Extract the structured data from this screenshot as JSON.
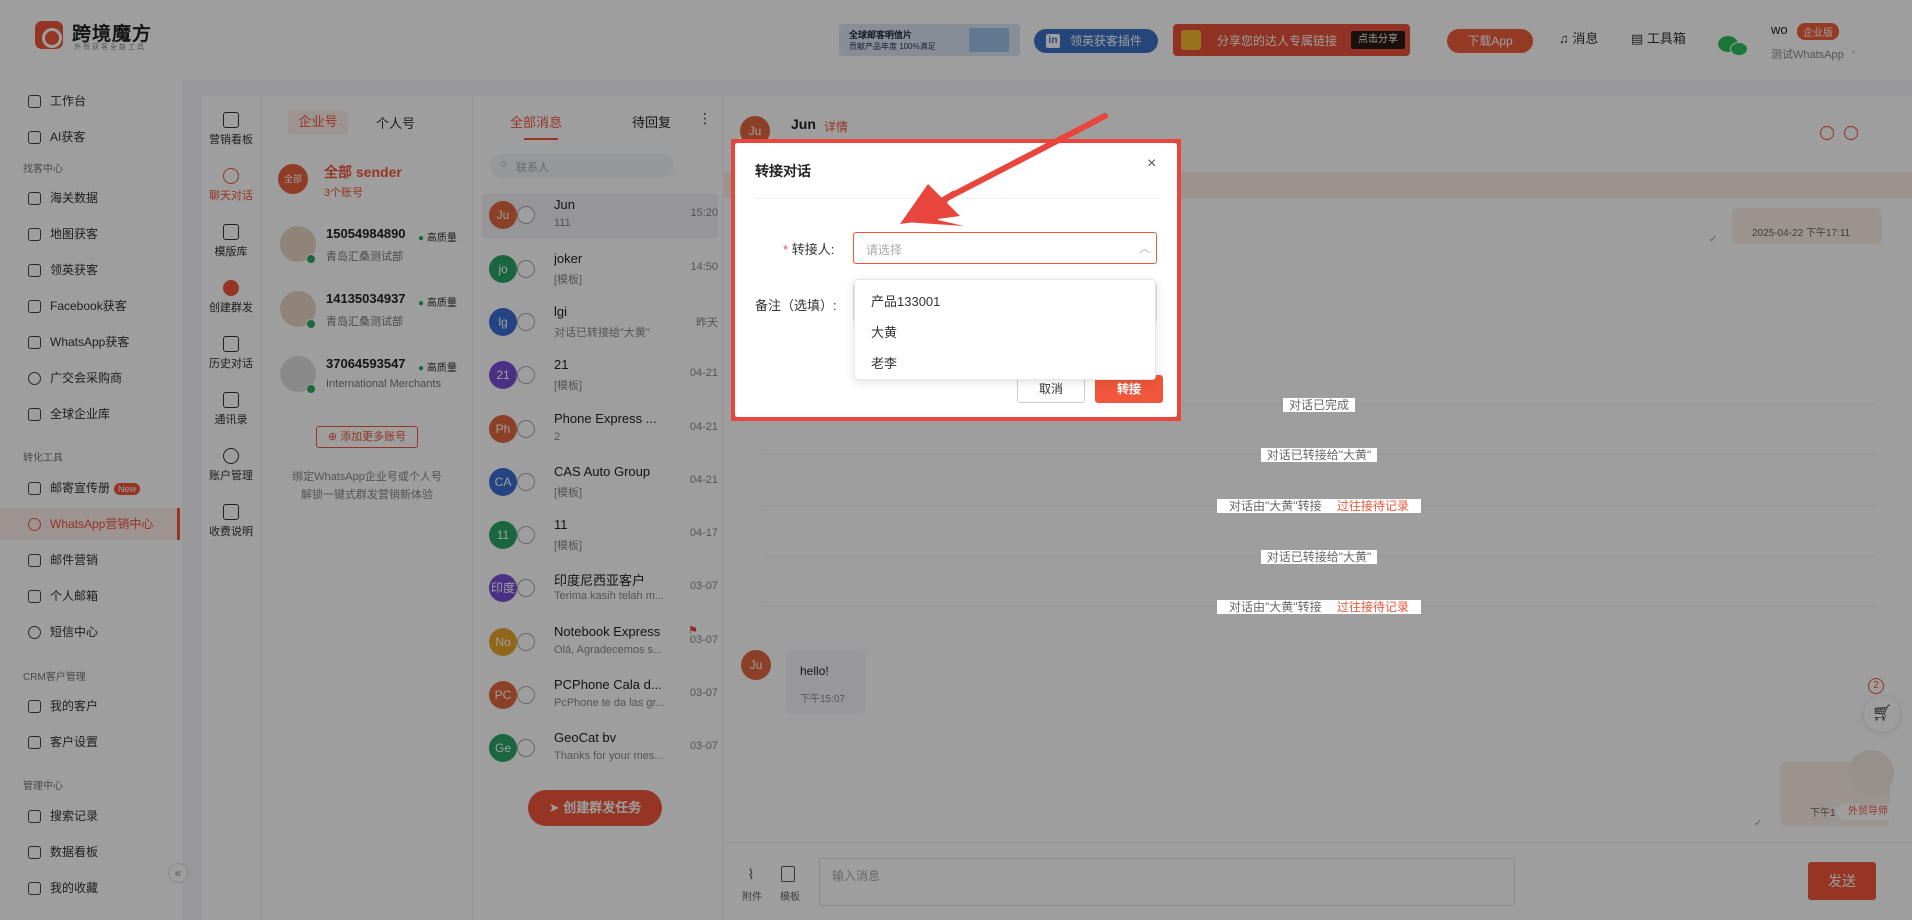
{
  "brand": {
    "name": "跨境魔方",
    "tagline": "外贸获客全能工具"
  },
  "header": {
    "banner1_line1": "全球邮客明信片",
    "banner1_line2": "贡献产品年度 100%满足",
    "linkedin_label": "领英获客插件",
    "share_label": "分享您的达人专属链接",
    "share_btn": "点击分享",
    "download_label": "下载App",
    "messages_label": "消息",
    "toolbox_label": "工具箱",
    "user_name": "wo",
    "user_badge": "企业版",
    "user_sub": "测试WhatsApp",
    "accent": "#f0563b"
  },
  "sidebar": {
    "top": [
      {
        "label": "工作台"
      },
      {
        "label": "AI获客"
      }
    ],
    "group1": "找客中心",
    "find": [
      {
        "label": "海关数据"
      },
      {
        "label": "地图获客"
      },
      {
        "label": "领英获客"
      },
      {
        "label": "Facebook获客"
      },
      {
        "label": "WhatsApp获客"
      },
      {
        "label": "广交会采购商"
      },
      {
        "label": "全球企业库"
      }
    ],
    "group2": "转化工具",
    "convert": [
      {
        "label": "邮寄宣传册"
      },
      {
        "label": "WhatsApp营销中心"
      },
      {
        "label": "邮件营销"
      },
      {
        "label": "个人邮箱"
      },
      {
        "label": "短信中心"
      }
    ],
    "new_badge": "New",
    "group3": "CRM客户管理",
    "crm": [
      {
        "label": "我的客户"
      },
      {
        "label": "客户设置"
      }
    ],
    "group4": "管理中心",
    "manage": [
      {
        "label": "搜索记录"
      },
      {
        "label": "数据看板"
      },
      {
        "label": "我的收藏"
      }
    ]
  },
  "tools": [
    {
      "label": "营销看板"
    },
    {
      "label": "聊天对话"
    },
    {
      "label": "模版库"
    },
    {
      "label": "创建群发"
    },
    {
      "label": "历史对话"
    },
    {
      "label": "通讯录"
    },
    {
      "label": "账户管理"
    },
    {
      "label": "收费说明"
    }
  ],
  "accounts": {
    "tab_business": "企业号",
    "tab_personal": "个人号",
    "all_sender": "全部 sender",
    "all_badge": "全部",
    "count": "3个账号",
    "quality": "高质量",
    "items": [
      {
        "number": "15054984890",
        "sub": "青岛汇桑测试部"
      },
      {
        "number": "14135034937",
        "sub": "青岛汇桑测试部"
      },
      {
        "number": "37064593547",
        "sub": "International Merchants"
      }
    ],
    "add_btn": "添加更多账号",
    "hint1": "绑定WhatsApp企业号或个人号",
    "hint2": "解锁一键式群发营销新体验"
  },
  "messages": {
    "tab_all": "全部消息",
    "tab_pending": "待回复",
    "search_placeholder": "联系人",
    "items": [
      {
        "initials": "Ju",
        "name": "Jun",
        "preview": "111",
        "time": "15:20",
        "color": "#e0683f"
      },
      {
        "initials": "jo",
        "name": "joker",
        "preview": "[模板]",
        "time": "14:50",
        "color": "#2aa56a"
      },
      {
        "initials": "lg",
        "name": "lgi",
        "preview": "对话已转接给\"大黄\"",
        "time": "昨天",
        "color": "#3c6fd6"
      },
      {
        "initials": "21",
        "name": "21",
        "preview": "[模板]",
        "time": "04-21",
        "color": "#7a4fd8"
      },
      {
        "initials": "Ph",
        "name": "Phone Express ...",
        "preview": "2",
        "time": "04-21",
        "color": "#e0683f"
      },
      {
        "initials": "CA",
        "name": "CAS Auto Group",
        "preview": "[模板]",
        "time": "04-21",
        "color": "#3c6fd6"
      },
      {
        "initials": "11",
        "name": "11",
        "preview": "[模板]",
        "time": "04-17",
        "color": "#2aa56a"
      },
      {
        "initials": "印度",
        "name": "印度尼西亚客户",
        "preview": "Terima kasih telah m...",
        "time": "03-07",
        "color": "#7a4fd8"
      },
      {
        "initials": "No",
        "name": "Notebook Express",
        "preview": "Olá, Agradecemos s...",
        "time": "03-07",
        "color": "#e8a52a"
      },
      {
        "initials": "PC",
        "name": "PCPhone Cala d...",
        "preview": "PcPhone te da las gr...",
        "time": "03-07",
        "color": "#e0683f"
      },
      {
        "initials": "Ge",
        "name": "GeoCat bv",
        "preview": "Thanks for your mes...",
        "time": "03-07",
        "color": "#2aa56a"
      }
    ],
    "create_btn": "创建群发任务"
  },
  "chat": {
    "avatar": "Ju",
    "name": "Jun",
    "detail": "详情",
    "timestamp": "2025-04-22 下午17:11",
    "sys1": "对话已完成",
    "sys2": "对话已转接给\"大黄\"",
    "sys3": "对话由\"大黄\"转接",
    "sys3_link": "过往接待记录",
    "sys4": "对话已转接给\"大黄\"",
    "sys5": "对话由\"大黄\"转接",
    "sys5_link": "过往接待记录",
    "bubble_text": "hello!",
    "bubble_time": "下午15:07",
    "right_time": "下午1",
    "cart_count": "2",
    "helper_label": "外贸导师",
    "attach_label": "附件",
    "template_label": "模板",
    "input_placeholder": "输入消息",
    "send_btn": "发送"
  },
  "dialog": {
    "title": "转接对话",
    "field_label": "转接人:",
    "required_mark": "*",
    "select_placeholder": "请选择",
    "note_label": "备注（选填）:",
    "options": [
      "产品133001",
      "大黄",
      "老李"
    ],
    "cancel_btn": "取消",
    "confirm_btn": "转接"
  }
}
